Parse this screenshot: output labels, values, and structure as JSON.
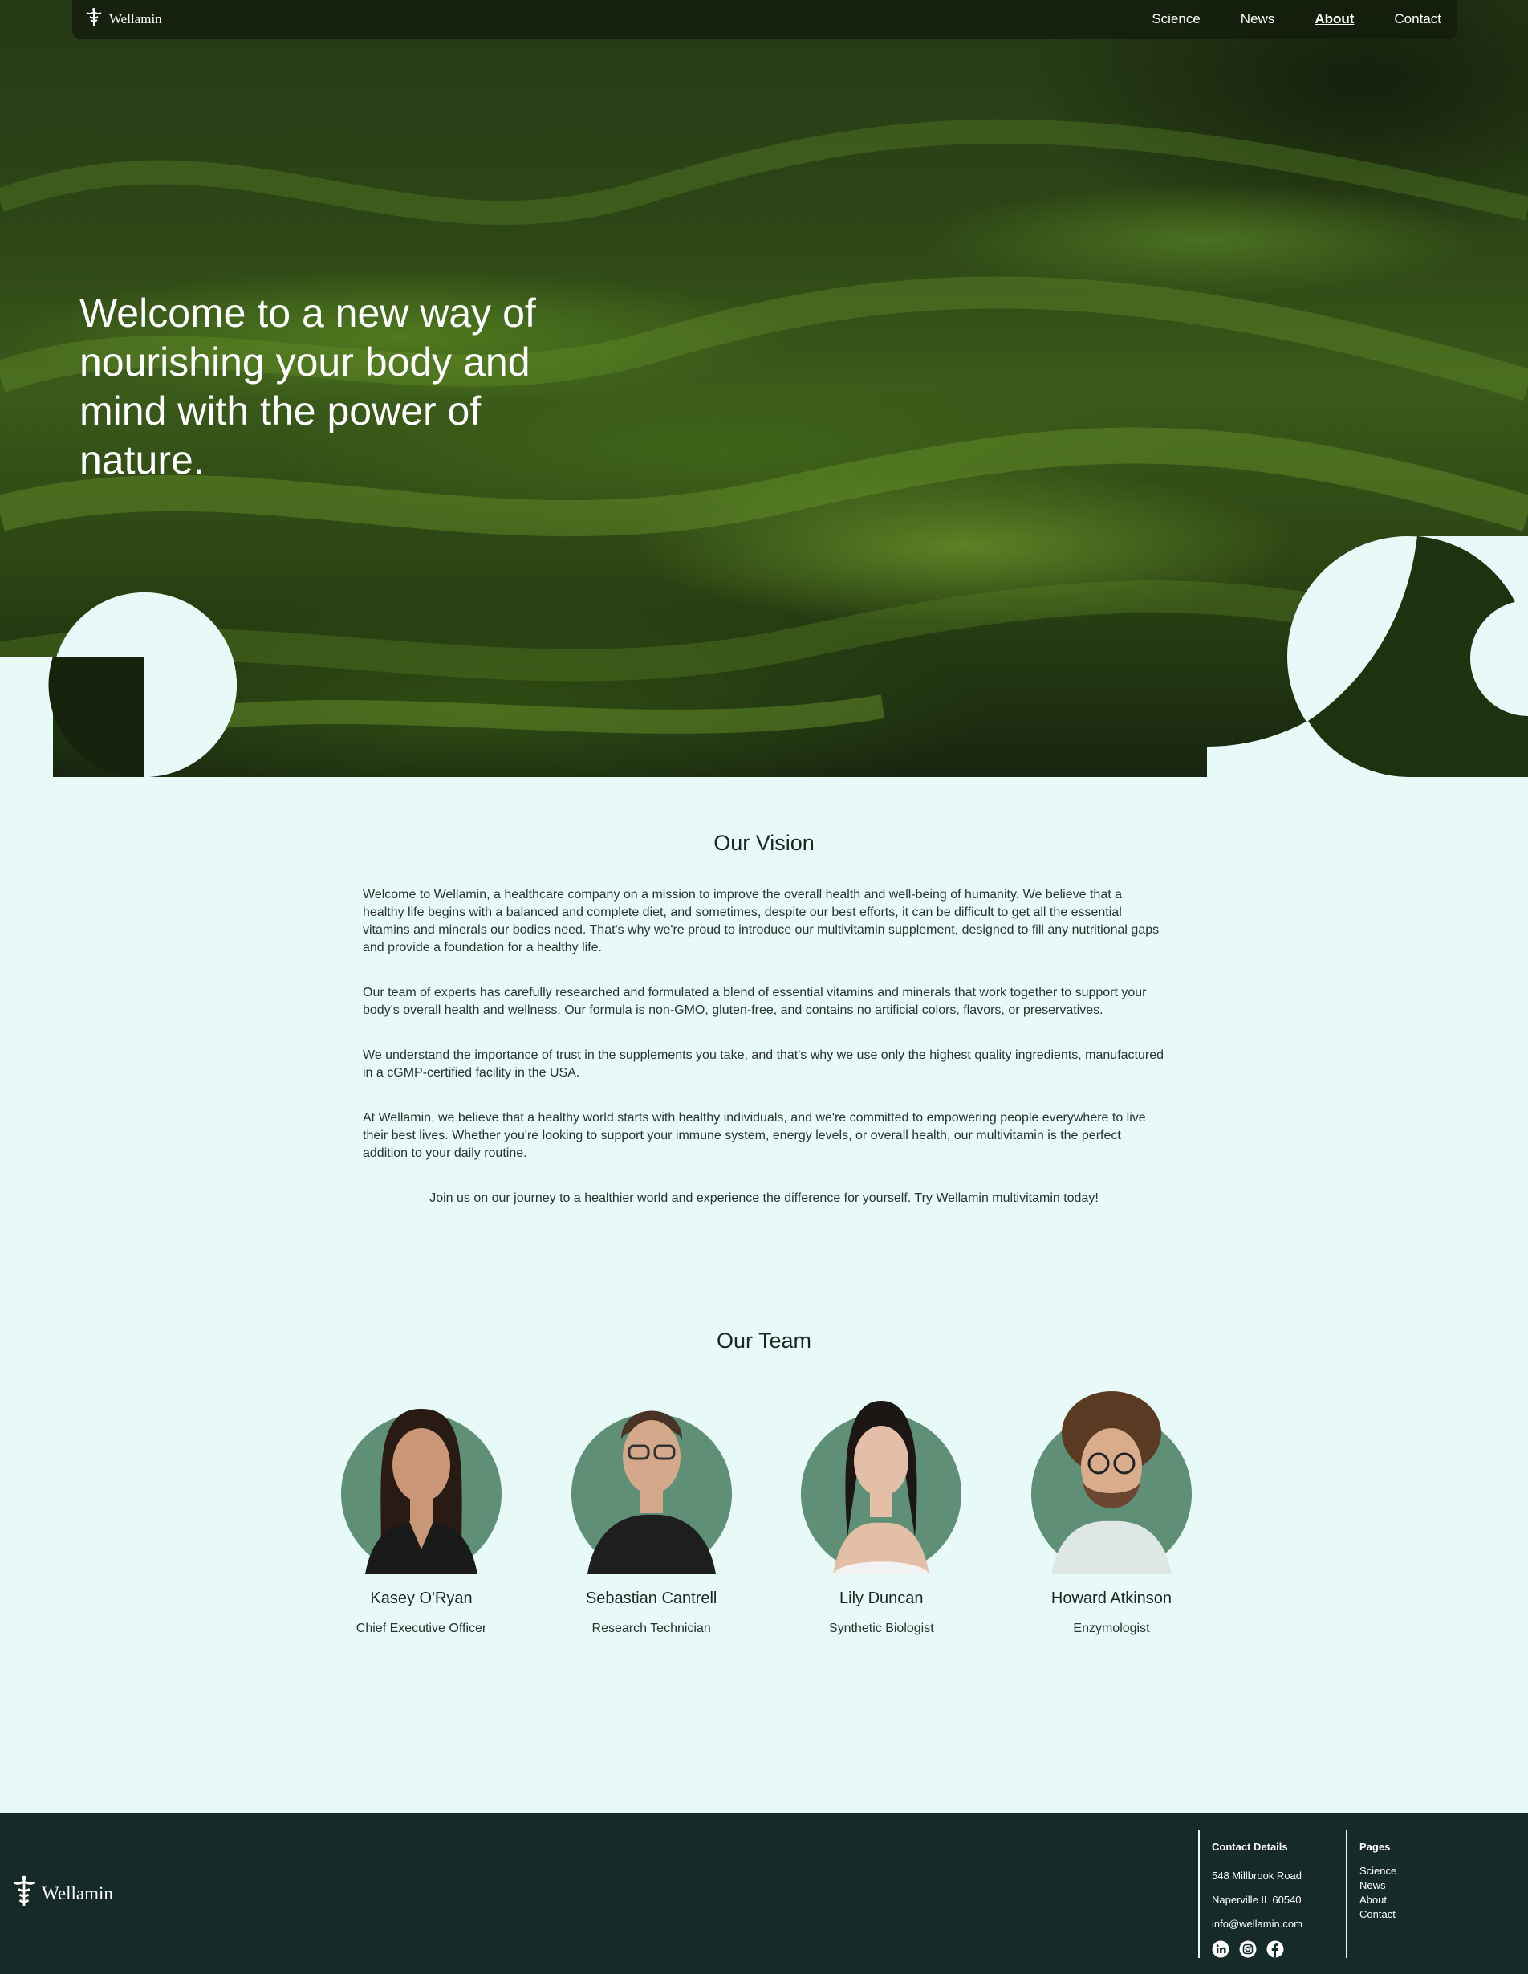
{
  "nav": {
    "brand": "Wellamin",
    "links": [
      {
        "label": "Science",
        "active": false
      },
      {
        "label": "News",
        "active": false
      },
      {
        "label": "About",
        "active": true
      },
      {
        "label": "Contact",
        "active": false
      }
    ]
  },
  "hero": {
    "heading": "Welcome to a new way of nourishing your body and mind with the power of nature."
  },
  "vision": {
    "title": "Our Vision",
    "paragraphs": [
      "Welcome to Wellamin, a healthcare company on a mission to improve the overall health and well-being of humanity. We believe that a healthy life begins with a balanced and complete diet, and sometimes, despite our best efforts, it can be difficult to get all the essential vitamins and minerals our bodies need. That's why we're proud to introduce our multivitamin supplement, designed to fill any nutritional gaps and provide a foundation for a healthy life.",
      "Our team of experts has carefully researched and formulated a blend of essential vitamins and minerals that work together to support your body's overall health and wellness. Our formula is non-GMO, gluten-free, and contains no artificial colors, flavors, or preservatives.",
      "We understand the importance of trust in the supplements you take, and that's why we use only the highest quality ingredients, manufactured in a cGMP-certified facility in the USA.",
      "At Wellamin, we believe that a healthy world starts with healthy individuals, and we're committed to empowering people everywhere to live their best lives. Whether you're looking to support your immune system, energy levels, or overall health, our multivitamin is the perfect addition to your daily routine.",
      "Join us on our journey to a healthier world and experience the difference for yourself. Try Wellamin multivitamin today!"
    ]
  },
  "team": {
    "title": "Our Team",
    "members": [
      {
        "name": "Kasey O'Ryan",
        "role": "Chief Executive Officer"
      },
      {
        "name": "Sebastian Cantrell",
        "role": "Research Technician"
      },
      {
        "name": "Lily Duncan",
        "role": "Synthetic Biologist"
      },
      {
        "name": "Howard Atkinson",
        "role": "Enzymologist"
      }
    ]
  },
  "footer": {
    "brand": "Wellamin",
    "contact": {
      "title": "Contact Details",
      "address1": "548 Millbrook Road",
      "address2": "Naperville IL 60540",
      "email": "info@wellamin.com",
      "social_icons": [
        "linkedin-icon",
        "instagram-icon",
        "facebook-icon"
      ]
    },
    "pages": {
      "title": "Pages",
      "links": [
        "Science",
        "News",
        "About",
        "Contact"
      ]
    }
  },
  "colors": {
    "page_bg": "#e8faf7",
    "footer_bg": "#162b28",
    "avatar_bg": "#5f9077",
    "text": "#1e2624"
  }
}
